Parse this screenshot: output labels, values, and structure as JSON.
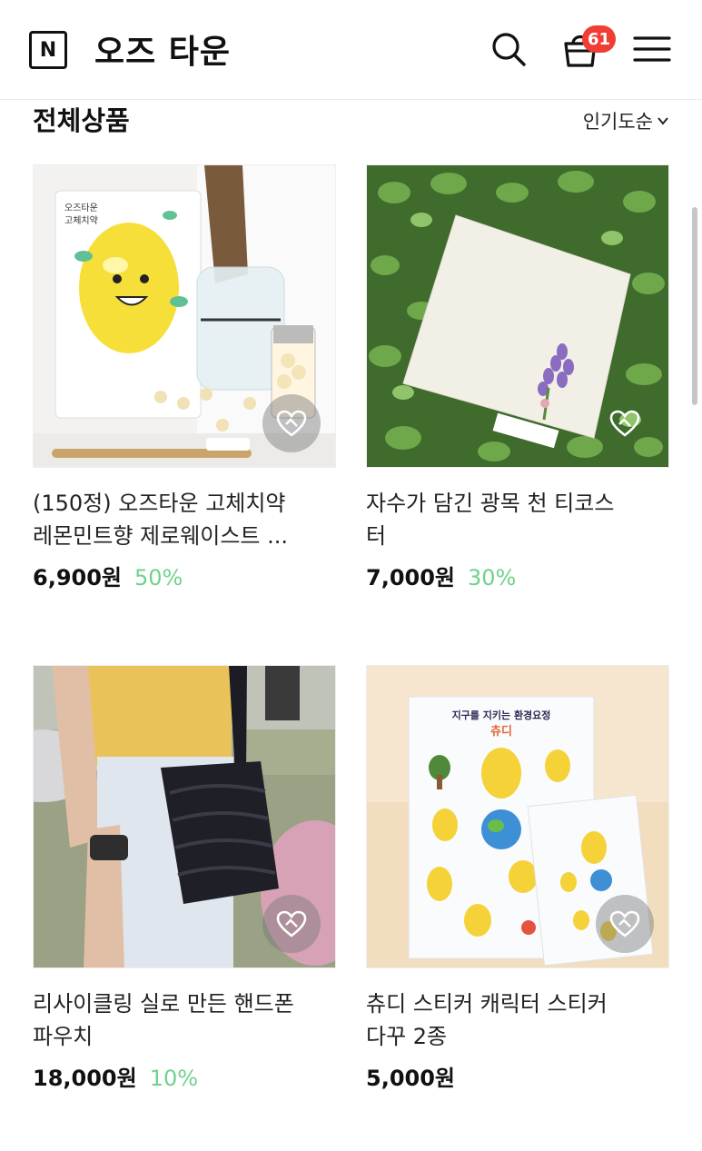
{
  "header": {
    "logo_letter": "N",
    "title": "오즈 타운",
    "cart_count": "61",
    "icons": [
      "search-icon",
      "shopping-bag-icon",
      "hamburger-menu-icon"
    ]
  },
  "section": {
    "title": "전체상품",
    "sort_label": "인기도순"
  },
  "products": [
    {
      "name_line1": "(150정) 오즈타운 고체치약",
      "name_line2": "레몬민트향 제로웨이스트 ...",
      "price": "6,900원",
      "discount": "50%"
    },
    {
      "name_line1": "자수가 담긴 광목 천 티코스",
      "name_line2": "터",
      "price": "7,000원",
      "discount": "30%"
    },
    {
      "name_line1": "리사이클링 실로 만든 핸드폰",
      "name_line2": "파우치",
      "price": "18,000원",
      "discount": "10%"
    },
    {
      "name_line1": "츄디 스티커 캐릭터 스티커",
      "name_line2": "다꾸 2종",
      "price": "5,000원",
      "discount": ""
    }
  ],
  "product_images": {
    "p1_pouch_line1": "오즈타운",
    "p1_pouch_line2": "고체치약",
    "p4_sheet_title": "지구를 지키는 환경요정",
    "p4_sheet_name": "츄디"
  },
  "colors": {
    "accent_discount": "#6fd28c",
    "badge": "#f03e35"
  }
}
